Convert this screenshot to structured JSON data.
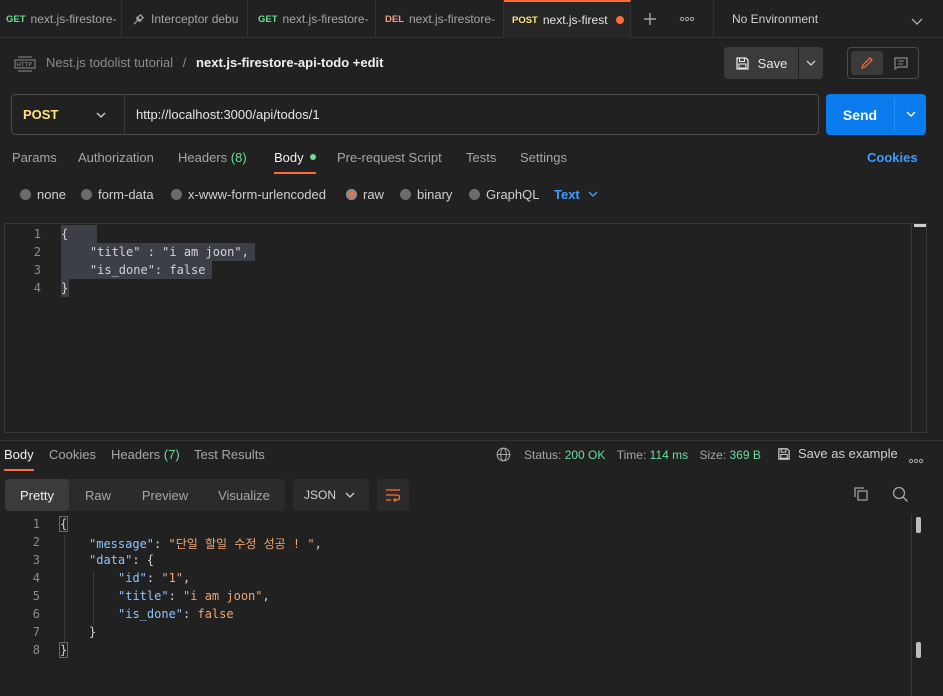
{
  "tabs": [
    {
      "method": "GET",
      "title": "next.js-firestore-"
    },
    {
      "method": "",
      "title": "Interceptor debu"
    },
    {
      "method": "GET",
      "title": "next.js-firestore-"
    },
    {
      "method": "DEL",
      "title": "next.js-firestore-"
    },
    {
      "method": "POST",
      "title": "next.js-firest"
    }
  ],
  "environment": "No Environment",
  "breadcrumb": {
    "collection": "Nest.js todolist tutorial",
    "separator": "/",
    "request": "next.js-firestore-api-todo +edit"
  },
  "save_label": "Save",
  "request": {
    "method": "POST",
    "url": "http://localhost:3000/api/todos/1"
  },
  "send_label": "Send",
  "request_tabs": {
    "params": "Params",
    "authorization": "Authorization",
    "headers": "Headers",
    "headers_count": "(8)",
    "body": "Body",
    "prerequest": "Pre-request Script",
    "tests": "Tests",
    "settings": "Settings",
    "cookies": "Cookies"
  },
  "body_types": {
    "none": "none",
    "form_data": "form-data",
    "urlencoded": "x-www-form-urlencoded",
    "raw": "raw",
    "binary": "binary",
    "graphql": "GraphQL",
    "format": "Text"
  },
  "request_body": {
    "line_numbers": [
      "1",
      "2",
      "3",
      "4"
    ],
    "lines": [
      "{",
      "    \"title\" : \"i am joon\",",
      "    \"is_done\": false",
      "}"
    ]
  },
  "response_tabs": {
    "body": "Body",
    "cookies": "Cookies",
    "headers": "Headers",
    "headers_count": "(7)",
    "test_results": "Test Results"
  },
  "response_status": {
    "status_label": "Status:",
    "status": "200 OK",
    "time_label": "Time:",
    "time": "114 ms",
    "size_label": "Size:",
    "size": "369 B",
    "save_example": "Save as example"
  },
  "response_view": {
    "pretty": "Pretty",
    "raw": "Raw",
    "preview": "Preview",
    "visualize": "Visualize",
    "format": "JSON"
  },
  "response_body": {
    "line_numbers": [
      "1",
      "2",
      "3",
      "4",
      "5",
      "6",
      "7",
      "8"
    ],
    "open_brace": "{",
    "message_key": "\"message\"",
    "message_value": "\"단일 할일 수정 성공 ! \"",
    "data_key": "\"data\"",
    "id_key": "\"id\"",
    "id_value": "\"1\"",
    "title_key": "\"title\"",
    "title_value": "\"i am joon\"",
    "is_done_key": "\"is_done\"",
    "is_done_value": "false",
    "inner_close": "}",
    "close_brace": "}"
  }
}
